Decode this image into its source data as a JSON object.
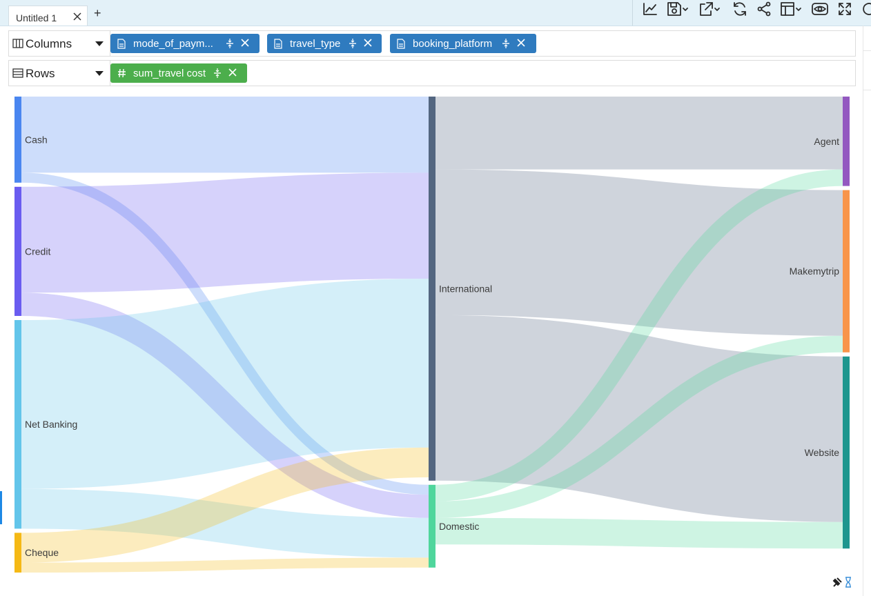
{
  "tab": {
    "label": "Untitled 1",
    "add_label": "+"
  },
  "toolbar": {
    "buttons": [
      {
        "name": "line-chart-icon"
      },
      {
        "name": "save-icon"
      },
      {
        "name": "export-icon"
      },
      {
        "name": "refresh-icon"
      },
      {
        "name": "share-icon"
      },
      {
        "name": "layout-icon"
      },
      {
        "name": "preview-eye-icon"
      },
      {
        "name": "fullscreen-icon"
      },
      {
        "name": "reload-icon"
      }
    ]
  },
  "shelves": {
    "columns": {
      "title": "Columns",
      "pills": [
        {
          "label": "mode_of_paym..."
        },
        {
          "label": "travel_type"
        },
        {
          "label": "booking_platform"
        }
      ]
    },
    "rows": {
      "title": "Rows",
      "pills": [
        {
          "label": "sum_travel cost"
        }
      ]
    }
  },
  "colors": {
    "Cash": "#4a86f0",
    "Credit": "#6a5cf0",
    "Net Banking": "#63c5ea",
    "Cheque": "#f5b915",
    "International": "#536680",
    "Domestic": "#4fd69c",
    "Agent": "#9358c0",
    "Makemytrip": "#f8954a",
    "Website": "#1e968e",
    "pill_blue": "#2f7bbf",
    "pill_green": "#4cae4c",
    "topbar": "#e3f1f8"
  },
  "chart_data": {
    "type": "sankey",
    "levels": [
      [
        "Cash",
        "Credit",
        "Net Banking",
        "Cheque"
      ],
      [
        "International",
        "Domestic"
      ],
      [
        "Agent",
        "Makemytrip",
        "Website"
      ]
    ],
    "links": [
      {
        "source": "Cash",
        "target": "International",
        "value": 11.5
      },
      {
        "source": "Cash",
        "target": "Domestic",
        "value": 1.5
      },
      {
        "source": "Credit",
        "target": "International",
        "value": 16
      },
      {
        "source": "Credit",
        "target": "Domestic",
        "value": 3.5
      },
      {
        "source": "Net Banking",
        "target": "International",
        "value": 25.5
      },
      {
        "source": "Net Banking",
        "target": "Domestic",
        "value": 6
      },
      {
        "source": "Cheque",
        "target": "International",
        "value": 4.5
      },
      {
        "source": "Cheque",
        "target": "Domestic",
        "value": 1.5
      },
      {
        "source": "International",
        "target": "Agent",
        "value": 11
      },
      {
        "source": "International",
        "target": "Makemytrip",
        "value": 22
      },
      {
        "source": "International",
        "target": "Website",
        "value": 25
      },
      {
        "source": "Domestic",
        "target": "Agent",
        "value": 2.5
      },
      {
        "source": "Domestic",
        "target": "Makemytrip",
        "value": 2.5
      },
      {
        "source": "Domestic",
        "target": "Website",
        "value": 4
      }
    ]
  }
}
